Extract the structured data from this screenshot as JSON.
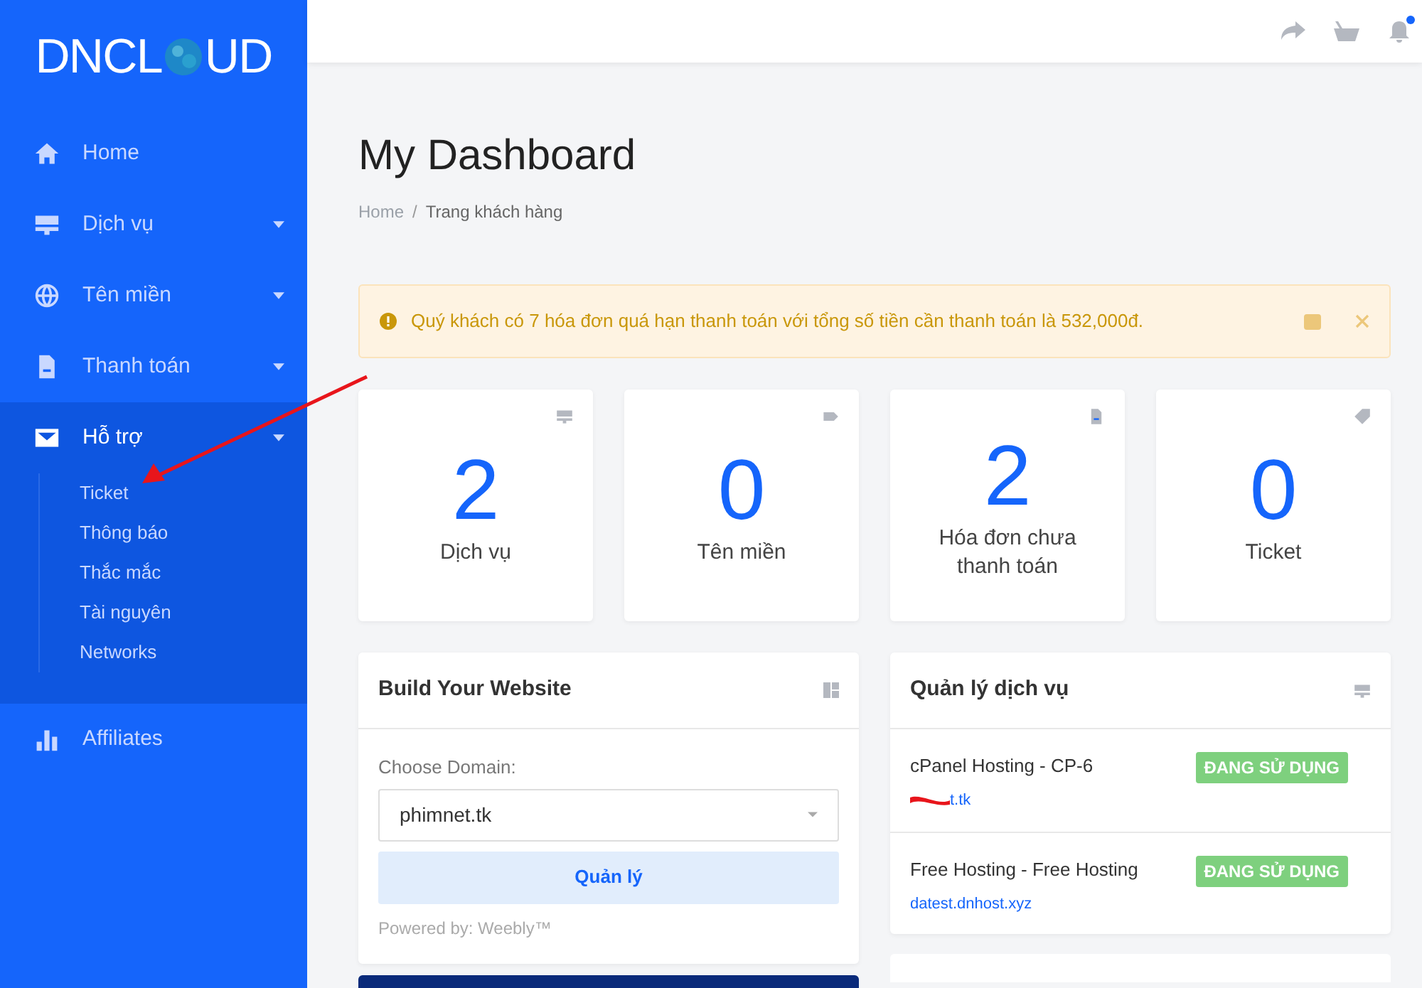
{
  "logo": {
    "text_left": "DNCL",
    "text_right": "UD"
  },
  "sidebar": {
    "items": [
      {
        "kind": "home",
        "label": "Home",
        "expanded": false,
        "has_caret": false
      },
      {
        "kind": "server",
        "label": "Dịch vụ",
        "expanded": false,
        "has_caret": true
      },
      {
        "kind": "globe",
        "label": "Tên miền",
        "expanded": false,
        "has_caret": true
      },
      {
        "kind": "file",
        "label": "Thanh toán",
        "expanded": false,
        "has_caret": true
      },
      {
        "kind": "envelope",
        "label": "Hỗ trợ",
        "expanded": true,
        "has_caret": true,
        "children": [
          {
            "label": "Ticket"
          },
          {
            "label": "Thông báo"
          },
          {
            "label": "Thắc mắc"
          },
          {
            "label": "Tài nguyên"
          },
          {
            "label": "Networks"
          }
        ]
      },
      {
        "kind": "chart",
        "label": "Affiliates",
        "expanded": false,
        "has_caret": false
      }
    ]
  },
  "topbar": {
    "notification_dot": true
  },
  "page": {
    "title": "My Dashboard",
    "breadcrumb": [
      "Home",
      "Trang khách hàng"
    ],
    "breadcrumb_separator": "/"
  },
  "alert": {
    "text": "Quý khách có 7 hóa đơn quá hạn thanh toán với tổng số tiền cần thanh toán là 532,000đ."
  },
  "stats": [
    {
      "kind": "server",
      "value": "2",
      "label": "Dịch vụ"
    },
    {
      "kind": "tag",
      "value": "0",
      "label": "Tên miền"
    },
    {
      "kind": "file",
      "value": "2",
      "label": "Hóa đơn chưa thanh toán"
    },
    {
      "kind": "ticket",
      "value": "0",
      "label": "Ticket"
    }
  ],
  "build_website": {
    "title": "Build Your Website",
    "field_label": "Choose Domain:",
    "domain": "phimnet.tk",
    "button": "Quản lý",
    "footer": "Powered by: Weebly™"
  },
  "services": {
    "title": "Quản lý dịch vụ",
    "rows": [
      {
        "name": "cPanel Hosting - CP-6",
        "link": "t.tk",
        "status": "ĐANG SỬ DỤNG",
        "redacted": true
      },
      {
        "name": "Free Hosting - Free Hosting",
        "link": "datest.dnhost.xyz",
        "status": "ĐANG SỬ DỤNG",
        "redacted": false
      }
    ]
  }
}
